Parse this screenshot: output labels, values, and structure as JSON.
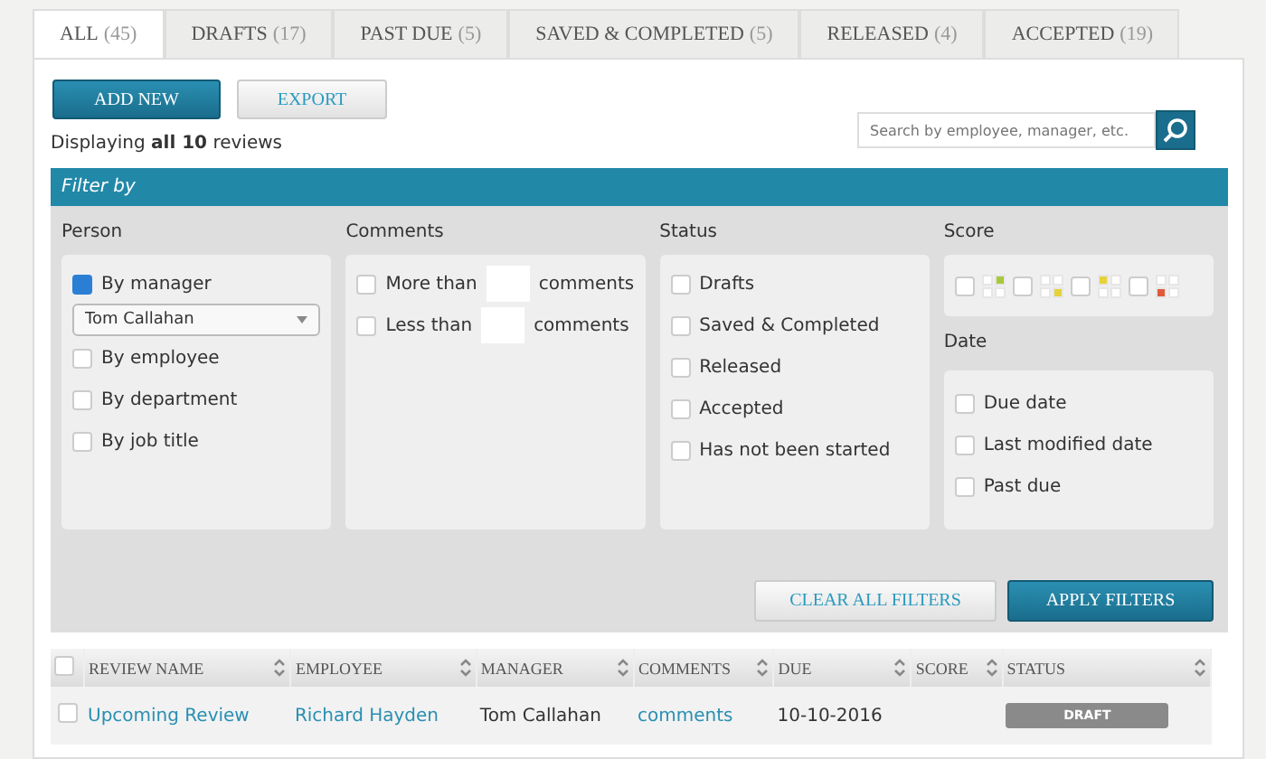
{
  "tabs": [
    {
      "label": "ALL",
      "count": "(45)",
      "selected": true
    },
    {
      "label": "DRAFTS",
      "count": "(17)",
      "selected": false
    },
    {
      "label": "PAST DUE",
      "count": "(5)",
      "selected": false
    },
    {
      "label": "SAVED & COMPLETED",
      "count": "(5)",
      "selected": false
    },
    {
      "label": "RELEASED",
      "count": "(4)",
      "selected": false
    },
    {
      "label": "ACCEPTED",
      "count": "(19)",
      "selected": false
    }
  ],
  "toolbar": {
    "buttons": [
      {
        "label": "ADD NEW",
        "kind": "primary"
      },
      {
        "label": "EXPORT",
        "kind": "secondary"
      }
    ],
    "summary": "Displaying **all 10** reviews",
    "search": {
      "placeholder": "Search by employee, manager, etc."
    }
  },
  "filter": {
    "title": "Filter by",
    "person": {
      "title": "Person",
      "options": [
        {
          "label": "By manager",
          "checked": true,
          "dropdown": "Tom Callahan"
        },
        {
          "label": "By employee",
          "checked": false
        },
        {
          "label": "By department",
          "checked": false
        },
        {
          "label": "By job title",
          "checked": false
        }
      ]
    },
    "comments": {
      "title": "Comments",
      "options": [
        {
          "before": "More than",
          "after": "comments",
          "checked": false
        },
        {
          "before": "Less than",
          "after": "comments",
          "checked": false
        }
      ]
    },
    "status": {
      "title": "Status",
      "options": [
        {
          "label": "Drafts",
          "checked": false
        },
        {
          "label": "Saved & Completed",
          "checked": false
        },
        {
          "label": "Released",
          "checked": false
        },
        {
          "label": "Accepted",
          "checked": false
        },
        {
          "label": "Has not been started",
          "checked": false
        }
      ]
    },
    "score": {
      "title": "Score",
      "options": [
        {
          "checked": false,
          "kind": "topright",
          "color": "#a6c93a"
        },
        {
          "checked": false,
          "kind": "bottomright",
          "color": "#e5d23a"
        },
        {
          "checked": false,
          "kind": "topleft",
          "color": "#e5d23a"
        },
        {
          "checked": false,
          "kind": "bottomleft",
          "color": "#e05a3a"
        }
      ]
    },
    "date": {
      "title": "Date",
      "options": [
        {
          "label": "Due date",
          "checked": false
        },
        {
          "label": "Last modified date",
          "checked": false
        },
        {
          "label": "Past due",
          "checked": false
        }
      ]
    },
    "buttons": [
      {
        "label": "CLEAR ALL FILTERS",
        "kind": "secondary"
      },
      {
        "label": "APPLY FILTERS",
        "kind": "primary"
      }
    ]
  },
  "table": {
    "select_all": false,
    "columns": [
      "REVIEW NAME",
      "EMPLOYEE",
      "MANAGER",
      "COMMENTS",
      "DUE",
      "SCORE",
      "STATUS"
    ],
    "rows": [
      {
        "checked": false,
        "review_name": "Upcoming Review",
        "employee": "Richard Hayden",
        "manager": "Tom Callahan",
        "comments": "comments",
        "due": "10-10-2016",
        "status": "DRAFT"
      }
    ]
  }
}
